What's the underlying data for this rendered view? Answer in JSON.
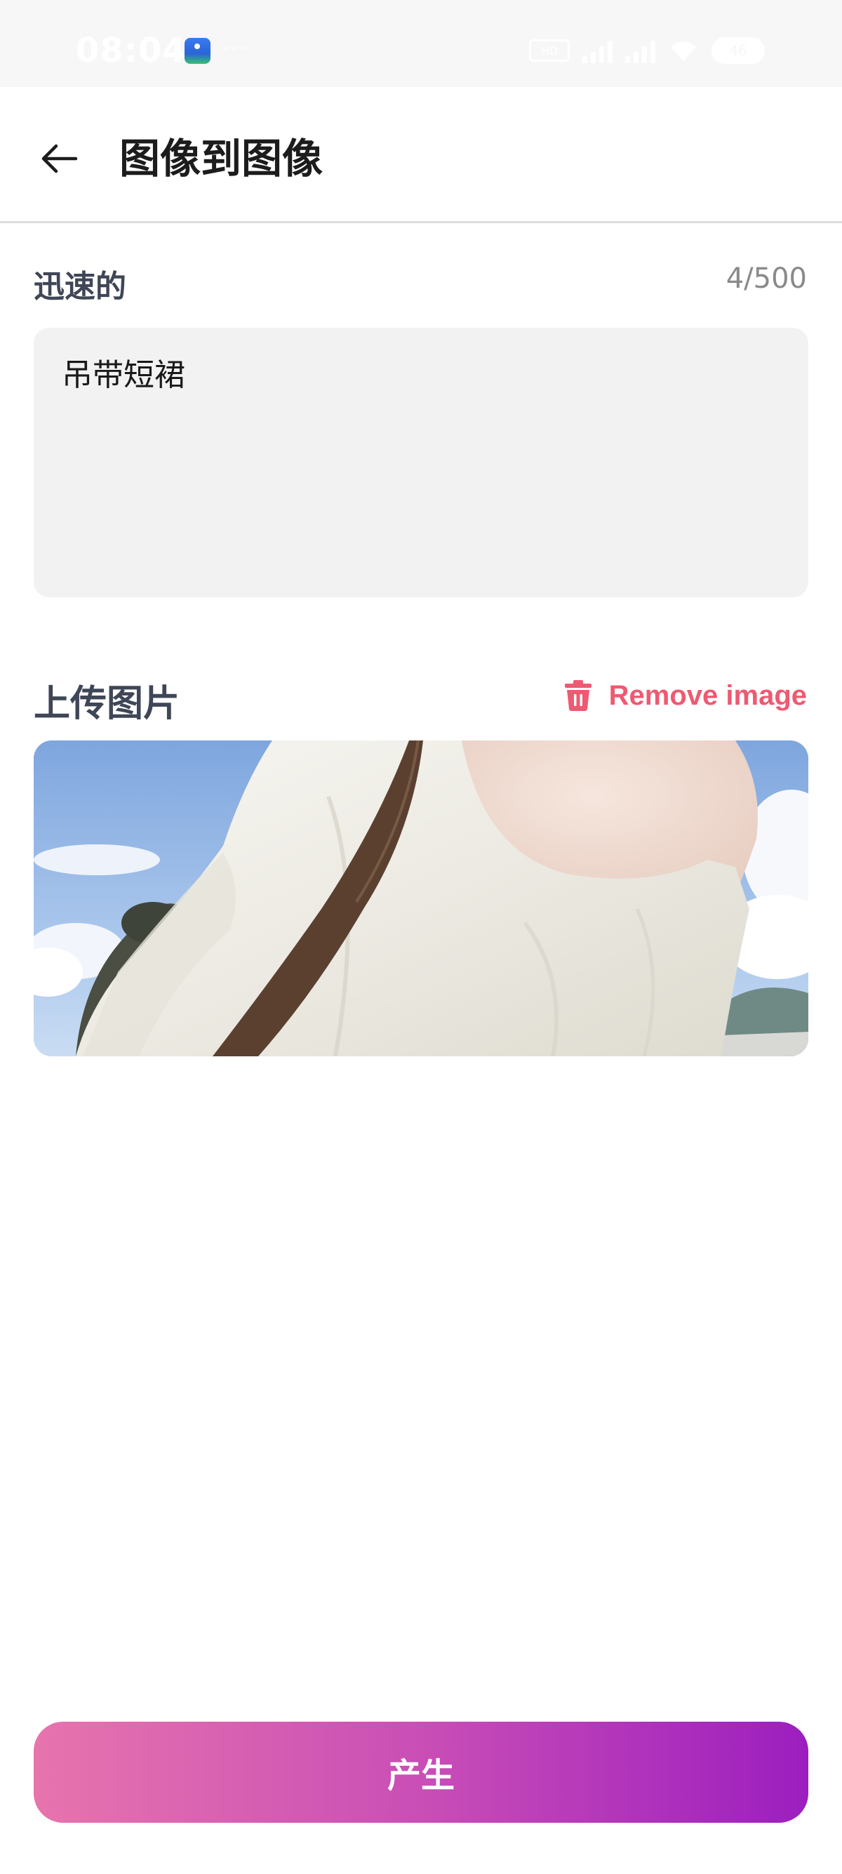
{
  "status_bar": {
    "time": "08:04",
    "more": "···",
    "hd_badge": "HD",
    "battery": "46"
  },
  "header": {
    "title": "图像到图像",
    "back_icon": "arrow-left-icon"
  },
  "prompt": {
    "label": "迅速的",
    "counter": "4/500",
    "value": "吊带短裙"
  },
  "upload": {
    "label": "上传图片",
    "remove_label": "Remove image",
    "remove_icon": "trash-icon",
    "remove_color": "#ee5a72"
  },
  "actions": {
    "generate_label": "产生",
    "gradient_start": "#e774ad",
    "gradient_end": "#9c1ebf"
  }
}
